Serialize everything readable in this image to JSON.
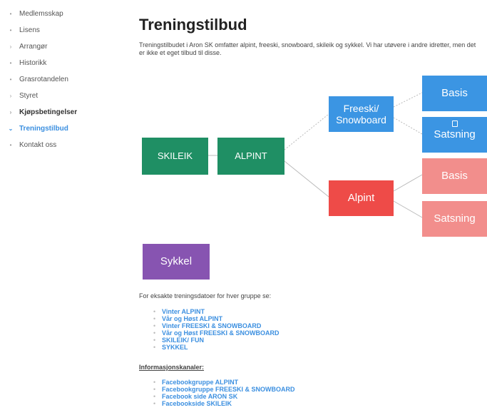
{
  "sidebar": {
    "items": [
      {
        "label": "Medlemsskap",
        "marker": "•"
      },
      {
        "label": "Lisens",
        "marker": "•"
      },
      {
        "label": "Arrangør",
        "marker": "›"
      },
      {
        "label": "Historikk",
        "marker": "•"
      },
      {
        "label": "Grasrotandelen",
        "marker": "•"
      },
      {
        "label": "Styret",
        "marker": "›"
      },
      {
        "label": "Kjøpsbetingelser",
        "marker": "›"
      },
      {
        "label": "Treningstilbud",
        "marker": "⌄"
      },
      {
        "label": "Kontakt oss",
        "marker": "•"
      }
    ]
  },
  "main": {
    "title": "Treningstilbud",
    "intro": "Treningstilbudet i Aron SK omfatter alpint, freeski, snowboard, skileik og sykkel. Vi har utøvere i andre idretter, men det er ikke et eget tilbud til disse."
  },
  "diagram": {
    "node_skileik": "SKILEIK",
    "node_alpint_u": "ALPINT",
    "node_freeski": "Freeski/\nSnowboard",
    "node_alpint": "Alpint",
    "node_basis_blue": "Basis",
    "node_satsning_blue": "Satsning",
    "node_basis_red": "Basis",
    "node_satsning_red": "Satsning",
    "node_sykkel": "Sykkel",
    "colors": {
      "green": "#1f8f64",
      "blue": "#3b95e3",
      "red": "#ee4b48",
      "pink": "#f28e8c",
      "purple": "#8754b1"
    }
  },
  "info": {
    "lead": "For eksakte treningsdatoer for hver gruppe se:",
    "links": [
      "Vinter ALPINT",
      "Vår og Høst ALPINT",
      "Vinter FREESKI & SNOWBOARD",
      "Vår og Høst FREESKI & SNOWBOARD",
      "SKILEIK/ FUN",
      "SYKKEL"
    ],
    "channels_heading": "Informasjonskanaler:",
    "channels": [
      "Facebookgruppe ALPINT",
      "Facebookgruppe FREESKI & SNOWBOARD",
      "Facebook side ARON SK",
      "Facebookside SKILEIK"
    ]
  }
}
